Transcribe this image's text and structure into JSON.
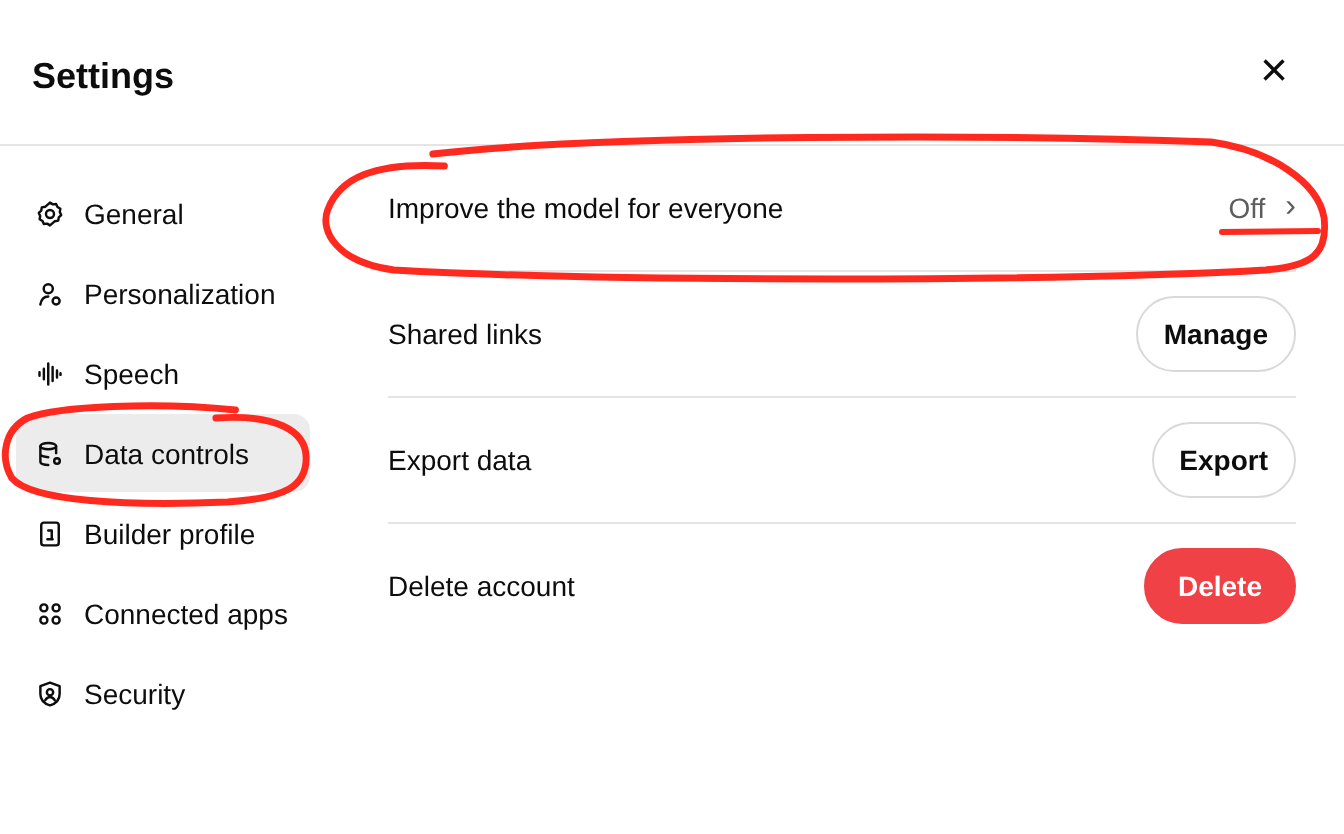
{
  "dialog": {
    "title": "Settings",
    "close": "×"
  },
  "sidebar": {
    "items": [
      {
        "label": "General",
        "kind": "gear",
        "selected": false,
        "circled": false
      },
      {
        "label": "Personalization",
        "kind": "person",
        "selected": false,
        "circled": false
      },
      {
        "label": "Speech",
        "kind": "wave",
        "selected": false,
        "circled": false
      },
      {
        "label": "Data controls",
        "kind": "database",
        "selected": true,
        "circled": true
      },
      {
        "label": "Builder profile",
        "kind": "badge",
        "selected": false,
        "circled": false
      },
      {
        "label": "Connected apps",
        "kind": "grid",
        "selected": false,
        "circled": false
      },
      {
        "label": "Security",
        "kind": "shield",
        "selected": false,
        "circled": false
      }
    ]
  },
  "rows": [
    {
      "label": "Improve the model for everyone",
      "kind": "link",
      "value": "Off",
      "chevron": "›",
      "circled": true,
      "underlined": true
    },
    {
      "label": "Shared links",
      "kind": "button",
      "button": "Manage",
      "danger": false
    },
    {
      "label": "Export data",
      "kind": "button",
      "button": "Export",
      "danger": false
    },
    {
      "label": "Delete account",
      "kind": "button",
      "button": "Delete",
      "danger": true
    }
  ]
}
